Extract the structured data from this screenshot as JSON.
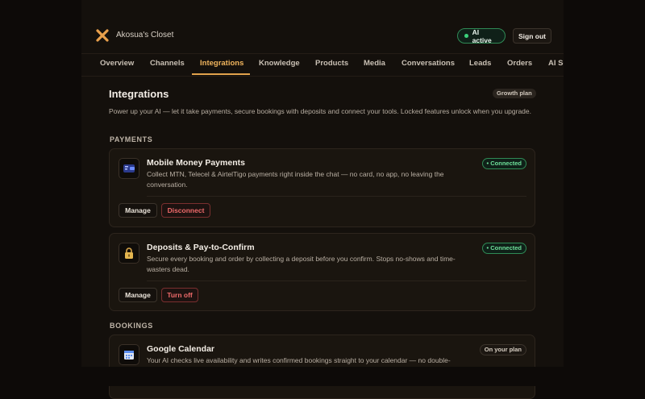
{
  "header": {
    "brand": "Akosua's Closet",
    "ai_status": "AI active",
    "signout": "Sign out"
  },
  "tabs": [
    {
      "label": "Overview"
    },
    {
      "label": "Channels"
    },
    {
      "label": "Integrations",
      "active": true
    },
    {
      "label": "Knowledge"
    },
    {
      "label": "Products"
    },
    {
      "label": "Media"
    },
    {
      "label": "Conversations"
    },
    {
      "label": "Leads"
    },
    {
      "label": "Orders"
    },
    {
      "label": "AI Se"
    }
  ],
  "page": {
    "title": "Integrations",
    "plan_badge": "Growth plan",
    "intro": "Power up your AI — let it take payments, secure bookings with deposits and connect your tools. Locked features unlock when you upgrade."
  },
  "sections": {
    "payments": "PAYMENTS",
    "bookings": "BOOKINGS"
  },
  "cards": {
    "momo": {
      "title": "Mobile Money Payments",
      "desc": "Collect MTN, Telecel & AirtelTigo payments right inside the chat — no card, no app, no leaving the conversation.",
      "status": "• Connected",
      "manage": "Manage",
      "action": "Disconnect"
    },
    "deposits": {
      "title": "Deposits & Pay-to-Confirm",
      "desc": "Secure every booking and order by collecting a deposit before you confirm. Stops no-shows and time-wasters dead.",
      "status": "• Connected",
      "manage": "Manage",
      "action": "Turn off"
    },
    "gcal": {
      "title": "Google Calendar",
      "desc": "Your AI checks live availability and writes confirmed bookings straight to your calendar — no double-",
      "status": "On your plan"
    }
  },
  "colors": {
    "accent": "#e2a24c",
    "connected": "#3bd17a",
    "danger": "#f06b6b",
    "background": "#14100c"
  },
  "icons": [
    "logo-x-icon",
    "wallet-icon",
    "lock-icon",
    "calendar-icon"
  ]
}
